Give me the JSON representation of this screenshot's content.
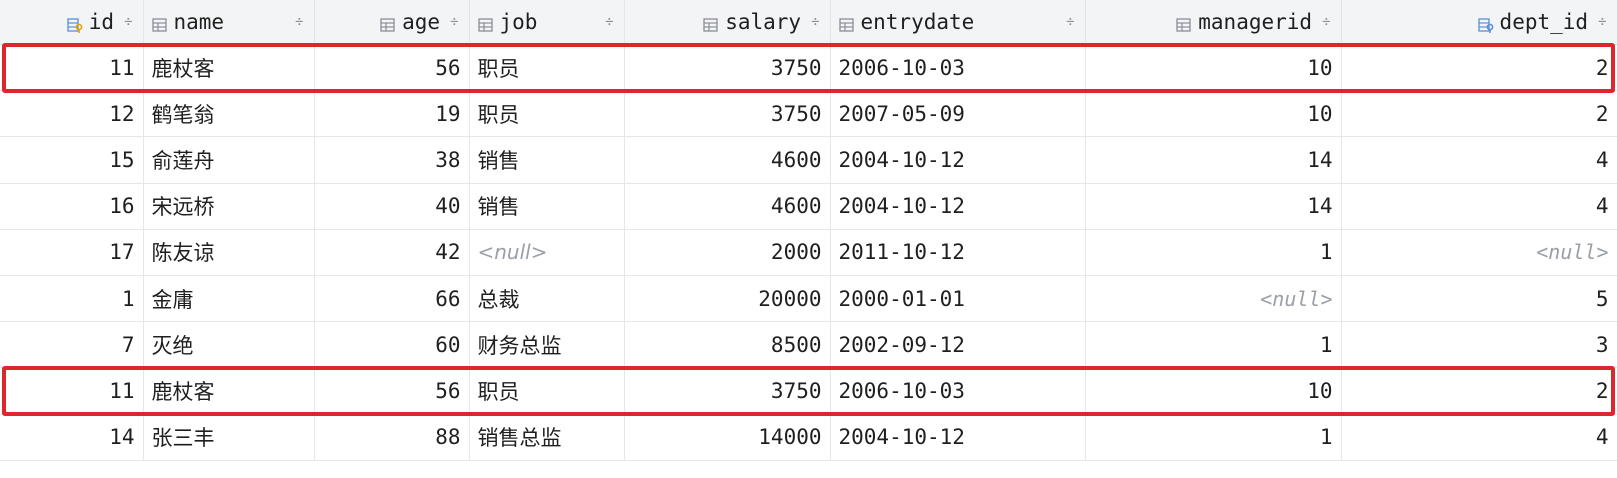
{
  "columns": [
    {
      "label": "id",
      "icon": "primary-key-column-icon",
      "align": "right"
    },
    {
      "label": "name",
      "icon": "column-icon",
      "align": "left"
    },
    {
      "label": "age",
      "icon": "column-icon",
      "align": "right"
    },
    {
      "label": "job",
      "icon": "column-icon",
      "align": "left"
    },
    {
      "label": "salary",
      "icon": "column-icon",
      "align": "right"
    },
    {
      "label": "entrydate",
      "icon": "column-icon",
      "align": "left"
    },
    {
      "label": "managerid",
      "icon": "column-icon",
      "align": "right"
    },
    {
      "label": "dept_id",
      "icon": "foreign-key-column-icon",
      "align": "right"
    }
  ],
  "sort_glyph": "÷",
  "null_text": "<null>",
  "rows": [
    {
      "id": "11",
      "name": "鹿杖客",
      "age": "56",
      "job": "职员",
      "salary": "3750",
      "entrydate": "2006-10-03",
      "managerid": "10",
      "dept_id": "2",
      "highlighted": true
    },
    {
      "id": "12",
      "name": "鹤笔翁",
      "age": "19",
      "job": "职员",
      "salary": "3750",
      "entrydate": "2007-05-09",
      "managerid": "10",
      "dept_id": "2",
      "highlighted": false
    },
    {
      "id": "15",
      "name": "俞莲舟",
      "age": "38",
      "job": "销售",
      "salary": "4600",
      "entrydate": "2004-10-12",
      "managerid": "14",
      "dept_id": "4",
      "highlighted": false
    },
    {
      "id": "16",
      "name": "宋远桥",
      "age": "40",
      "job": "销售",
      "salary": "4600",
      "entrydate": "2004-10-12",
      "managerid": "14",
      "dept_id": "4",
      "highlighted": false
    },
    {
      "id": "17",
      "name": "陈友谅",
      "age": "42",
      "job": null,
      "salary": "2000",
      "entrydate": "2011-10-12",
      "managerid": "1",
      "dept_id": null,
      "highlighted": false
    },
    {
      "id": "1",
      "name": "金庸",
      "age": "66",
      "job": "总裁",
      "salary": "20000",
      "entrydate": "2000-01-01",
      "managerid": null,
      "dept_id": "5",
      "highlighted": false
    },
    {
      "id": "7",
      "name": "灭绝",
      "age": "60",
      "job": "财务总监",
      "salary": "8500",
      "entrydate": "2002-09-12",
      "managerid": "1",
      "dept_id": "3",
      "highlighted": false
    },
    {
      "id": "11",
      "name": "鹿杖客",
      "age": "56",
      "job": "职员",
      "salary": "3750",
      "entrydate": "2006-10-03",
      "managerid": "10",
      "dept_id": "2",
      "highlighted": true
    },
    {
      "id": "14",
      "name": "张三丰",
      "age": "88",
      "job": "销售总监",
      "salary": "14000",
      "entrydate": "2004-10-12",
      "managerid": "1",
      "dept_id": "4",
      "highlighted": false
    }
  ],
  "colors": {
    "header_bg": "#f3f4f6",
    "grid_line": "#e6e7ea",
    "highlight_border": "#e0262d",
    "null_text": "#9aa0a6",
    "icon_blue": "#5b8fd6",
    "icon_gray": "#8a8f96",
    "key_gold": "#e2a400"
  }
}
